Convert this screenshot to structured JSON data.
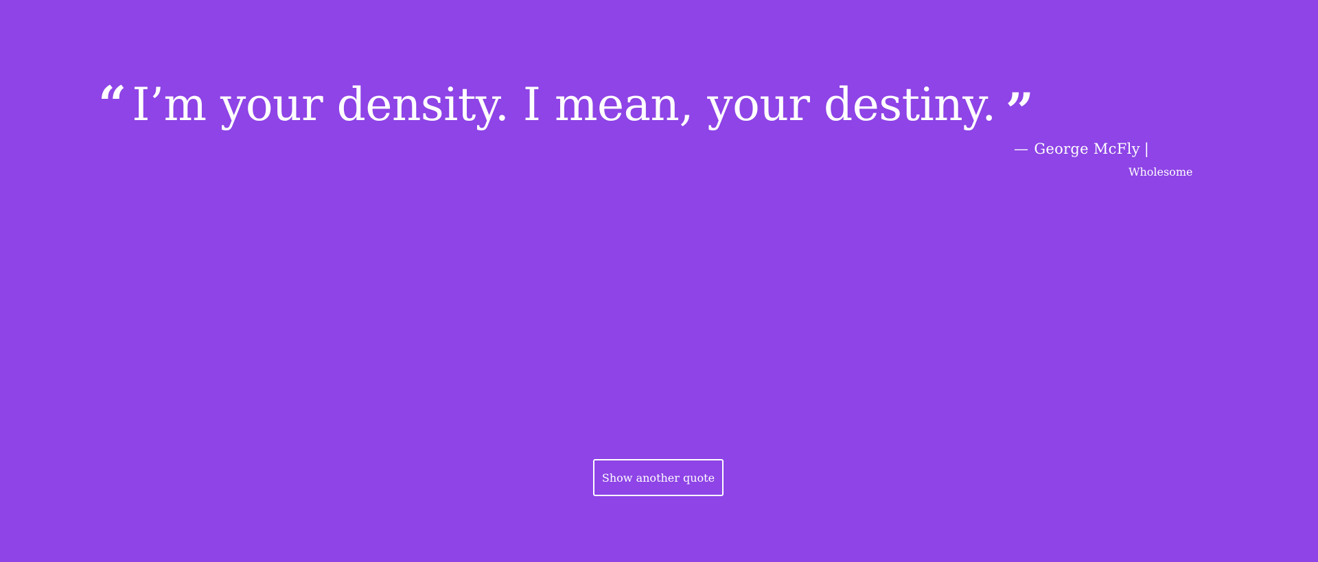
{
  "quote": {
    "open_mark": "“",
    "text": "I’m your density. I mean, your destiny.",
    "close_mark": "”"
  },
  "attribution": {
    "dash": "—",
    "author": "George McFly",
    "separator": "|",
    "tag": "Wholesome"
  },
  "actions": {
    "next_label": "Show another quote"
  },
  "colors": {
    "background": "#8e44e6",
    "foreground": "#ffffff"
  }
}
